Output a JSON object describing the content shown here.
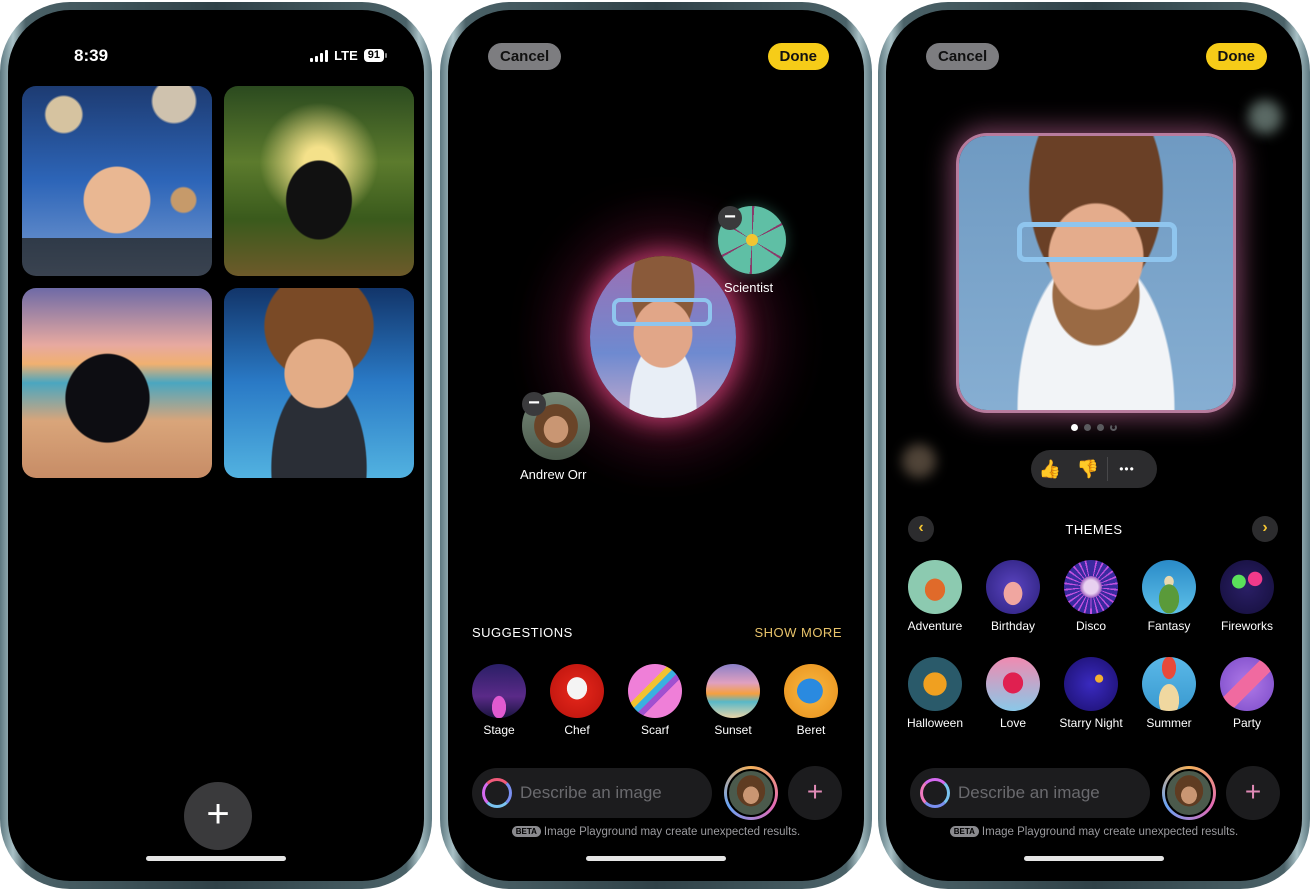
{
  "phone1": {
    "status": {
      "time": "8:39",
      "network": "LTE",
      "battery": "91"
    },
    "gallery": [
      {
        "name": "space-portrait"
      },
      {
        "name": "jungle-cat"
      },
      {
        "name": "beach-cat"
      },
      {
        "name": "space-portrait-2"
      }
    ],
    "add_button": "+"
  },
  "phone2": {
    "cancel_label": "Cancel",
    "done_label": "Done",
    "concepts": [
      {
        "label": "Scientist"
      },
      {
        "label": "Andrew Orr"
      }
    ],
    "remove_glyph": "−",
    "suggestions_title": "SUGGESTIONS",
    "show_more_label": "SHOW MORE",
    "suggestions": [
      {
        "label": "Stage"
      },
      {
        "label": "Chef"
      },
      {
        "label": "Scarf"
      },
      {
        "label": "Sunset"
      },
      {
        "label": "Beret"
      }
    ],
    "input_placeholder": "Describe an image",
    "plus_label": "+",
    "beta_badge": "BETA",
    "beta_note": "Image Playground may create unexpected results."
  },
  "phone3": {
    "cancel_label": "Cancel",
    "done_label": "Done",
    "pagination": {
      "current": 1,
      "total": 4,
      "loading_last": true
    },
    "feedback": {
      "like": "👍",
      "dislike": "👎",
      "more": "•••"
    },
    "themes_title": "THEMES",
    "prev_glyph": "‹",
    "next_glyph": "›",
    "themes": [
      {
        "label": "Adventure"
      },
      {
        "label": "Birthday"
      },
      {
        "label": "Disco"
      },
      {
        "label": "Fantasy"
      },
      {
        "label": "Fireworks"
      },
      {
        "label": "Halloween"
      },
      {
        "label": "Love"
      },
      {
        "label": "Starry Night"
      },
      {
        "label": "Summer"
      },
      {
        "label": "Party"
      }
    ],
    "input_placeholder": "Describe an image",
    "plus_label": "+",
    "beta_badge": "BETA",
    "beta_note": "Image Playground may create unexpected results."
  },
  "colors": {
    "accent_yellow": "#f6cc18",
    "show_more": "#e8c36a",
    "cancel_bg": "#7d7d80"
  }
}
